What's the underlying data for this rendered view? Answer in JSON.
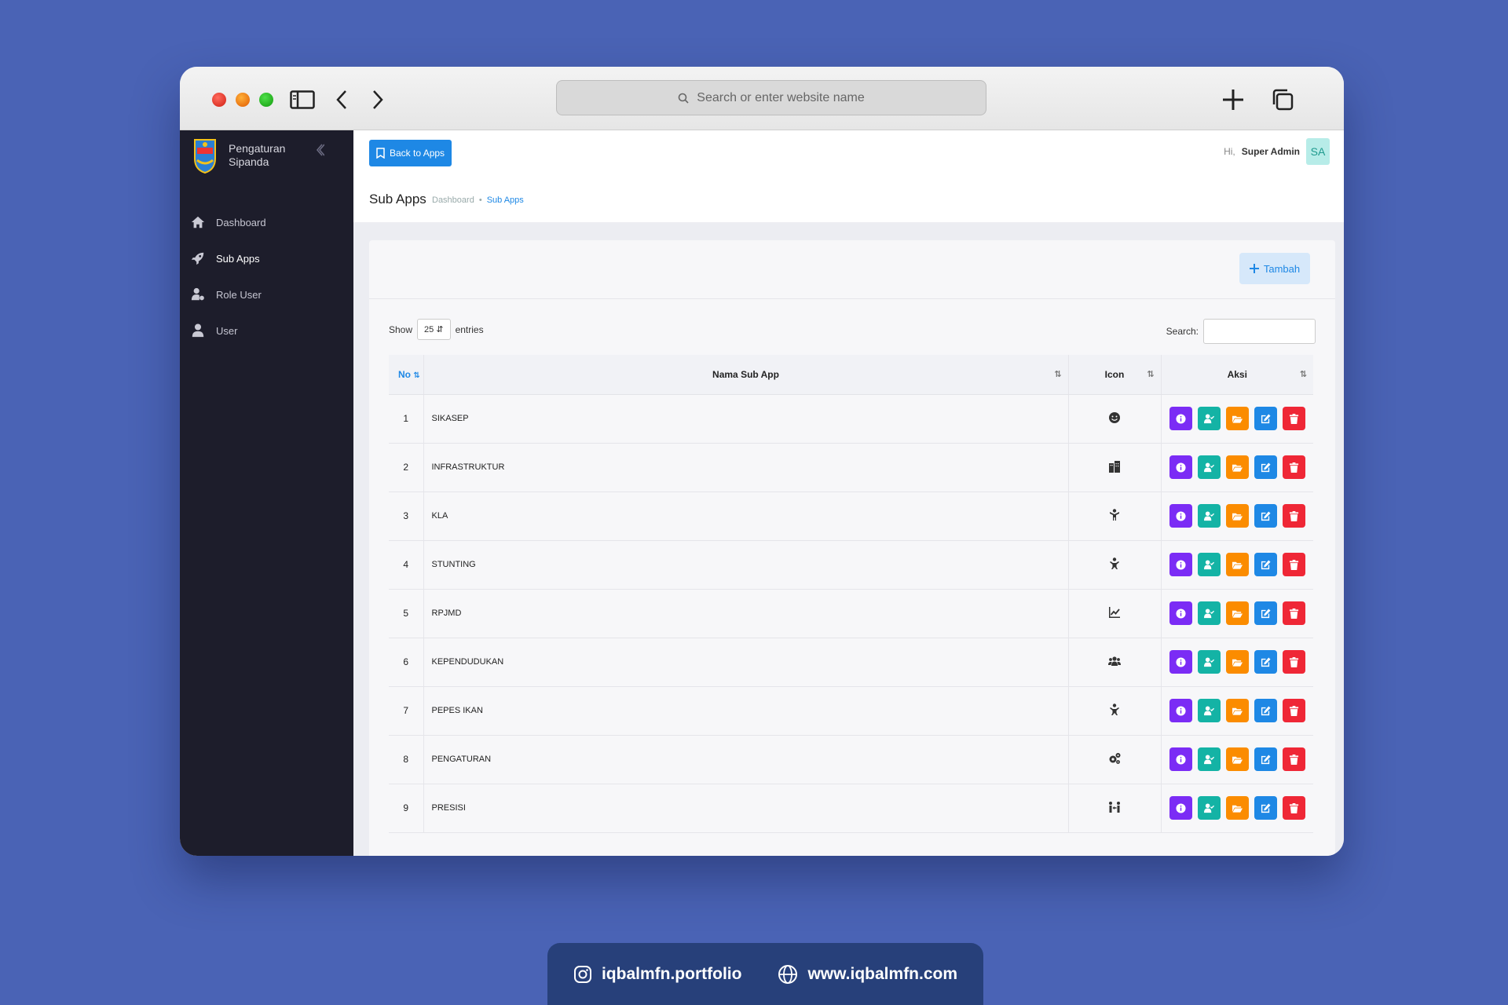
{
  "browser": {
    "url_placeholder": "Search or enter website name"
  },
  "sidebar": {
    "brand": [
      "Pengaturan",
      "Sipanda"
    ],
    "items": [
      {
        "label": "Dashboard",
        "icon": "home-icon"
      },
      {
        "label": "Sub Apps",
        "icon": "rocket-icon"
      },
      {
        "label": "Role User",
        "icon": "user-cog-icon"
      },
      {
        "label": "User",
        "icon": "user-icon"
      }
    ]
  },
  "topbar": {
    "back_label": "Back to Apps",
    "greeting": "Hi,",
    "user_name": "Super Admin",
    "avatar": "SA"
  },
  "page": {
    "title": "Sub Apps",
    "breadcrumb": [
      "Dashboard",
      "Sub Apps"
    ]
  },
  "card": {
    "add_label": "Tambah",
    "show_label": "Show",
    "show_value": "25",
    "entries_label": "entries",
    "search_label": "Search:"
  },
  "table": {
    "headers": {
      "no": "No",
      "name": "Nama Sub App",
      "icon": "Icon",
      "actions": "Aksi"
    },
    "rows": [
      {
        "no": "1",
        "name": "SIKASEP",
        "icon": "smile-icon"
      },
      {
        "no": "2",
        "name": "INFRASTRUKTUR",
        "icon": "city-icon"
      },
      {
        "no": "3",
        "name": "KLA",
        "icon": "child-icon"
      },
      {
        "no": "4",
        "name": "STUNTING",
        "icon": "child-reaching-icon"
      },
      {
        "no": "5",
        "name": "RPJMD",
        "icon": "chart-line-icon"
      },
      {
        "no": "6",
        "name": "KEPENDUDUKAN",
        "icon": "users-icon"
      },
      {
        "no": "7",
        "name": "PEPES IKAN",
        "icon": "child-reaching-icon"
      },
      {
        "no": "8",
        "name": "PENGATURAN",
        "icon": "cogs-icon"
      },
      {
        "no": "9",
        "name": "PRESISI",
        "icon": "people-arrows-icon"
      }
    ]
  },
  "footer": {
    "instagram": "iqbalmfn.portfolio",
    "website": "www.iqbalmfn.com"
  }
}
